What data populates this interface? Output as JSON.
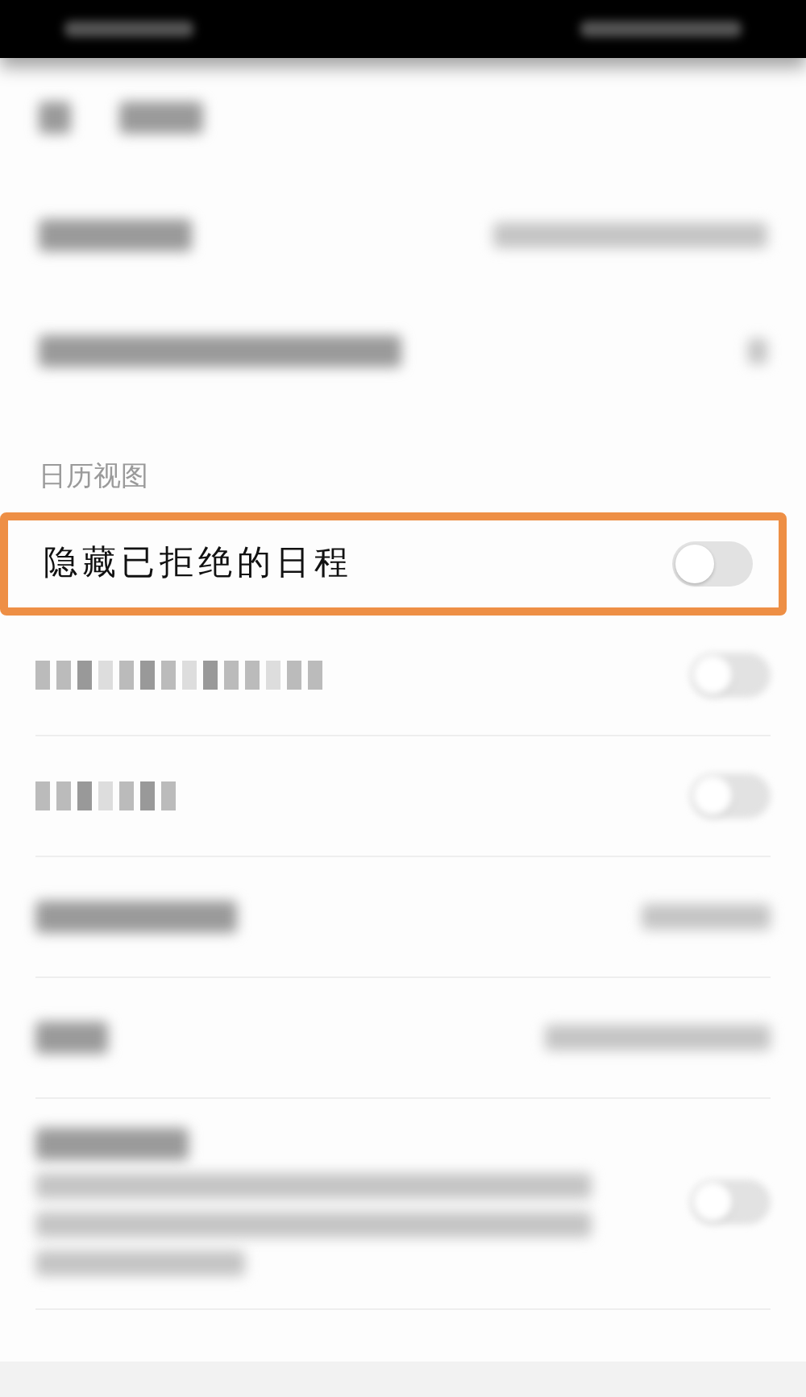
{
  "status_bar": {
    "kind": "blurred"
  },
  "header": {
    "kind": "blurred"
  },
  "rows": [
    {
      "kind": "blurred-link"
    },
    {
      "kind": "blurred-link"
    }
  ],
  "section": {
    "title": "日历视图"
  },
  "section_rows": [
    {
      "kind": "toggle",
      "label": "隐藏已拒绝的日程",
      "on": false,
      "highlighted": true
    },
    {
      "kind": "pixelated-toggle",
      "on": false,
      "highlighted": false
    },
    {
      "kind": "pixelated-toggle",
      "on": false,
      "highlighted": false
    },
    {
      "kind": "blurred-link",
      "highlighted": false
    },
    {
      "kind": "blurred-link",
      "highlighted": false
    },
    {
      "kind": "blurred-toggle-desc",
      "on": false,
      "highlighted": false
    }
  ]
}
